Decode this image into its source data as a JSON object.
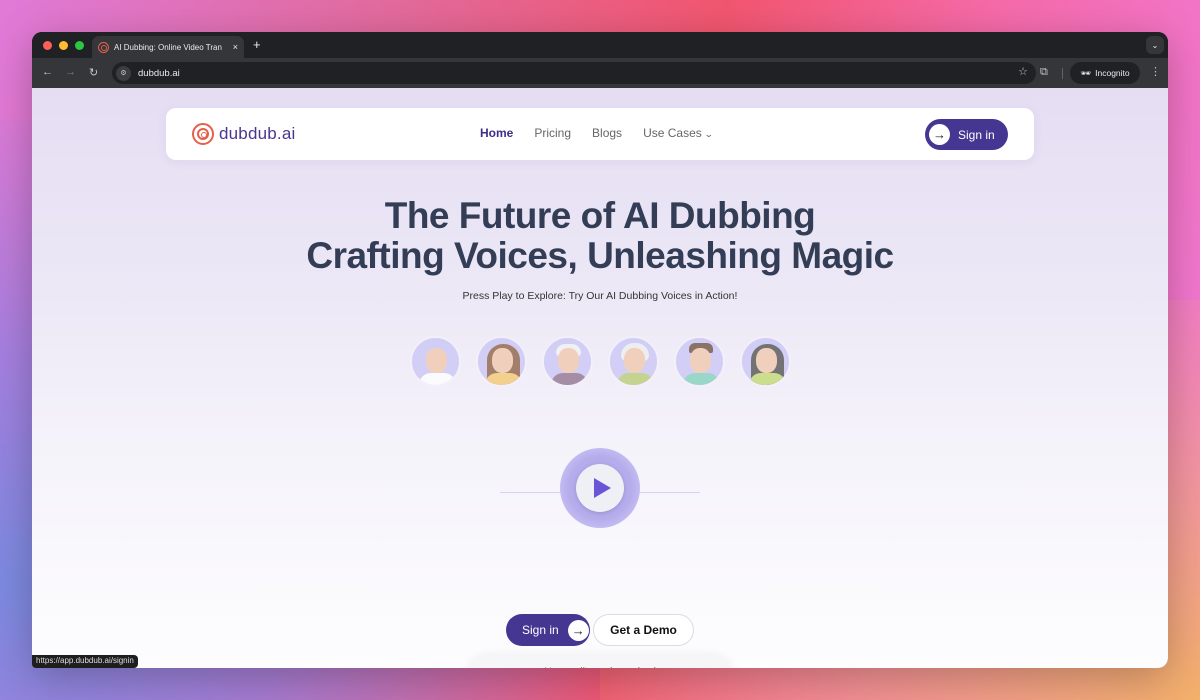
{
  "browser": {
    "tab_title": "AI Dubbing: Online Video Tran",
    "tab_close": "×",
    "new_tab": "+",
    "url": "dubdub.ai",
    "incognito_label": "Incognito",
    "status_url": "https://app.dubdub.ai/signin",
    "icons": {
      "back": "←",
      "forward": "→",
      "reload": "↻",
      "site_info": "⚙",
      "star": "☆",
      "extensions": "⧉",
      "incognito": "🕶",
      "menu": "⋮",
      "tab_menu": "⌄"
    }
  },
  "navbar": {
    "logo_text": "dubdub.ai",
    "links": [
      {
        "label": "Home",
        "active": true
      },
      {
        "label": "Pricing",
        "active": false
      },
      {
        "label": "Blogs",
        "active": false
      },
      {
        "label": "Use Cases",
        "active": false,
        "dropdown": true
      }
    ],
    "chevron": "⌄",
    "signin_label": "Sign in",
    "arrow": "→"
  },
  "hero": {
    "title_line1": "The Future of AI Dubbing",
    "title_line2": "Crafting Voices, Unleashing Magic",
    "subtitle": "Press Play to Explore: Try Our AI Dubbing Voices in Action!",
    "avatars": [
      {
        "name": "bald-man-glasses"
      },
      {
        "name": "woman-brown-hair"
      },
      {
        "name": "old-man-glasses"
      },
      {
        "name": "old-woman-glasses"
      },
      {
        "name": "young-man"
      },
      {
        "name": "woman-dark-hair"
      }
    ]
  },
  "cta": {
    "signin_label": "Sign in",
    "arrow": "→",
    "demo_label": "Get a Demo",
    "note": "No credit card required"
  },
  "colors": {
    "brand": "#453691",
    "logo_mark": "#e4604d",
    "heading": "#333d55"
  }
}
